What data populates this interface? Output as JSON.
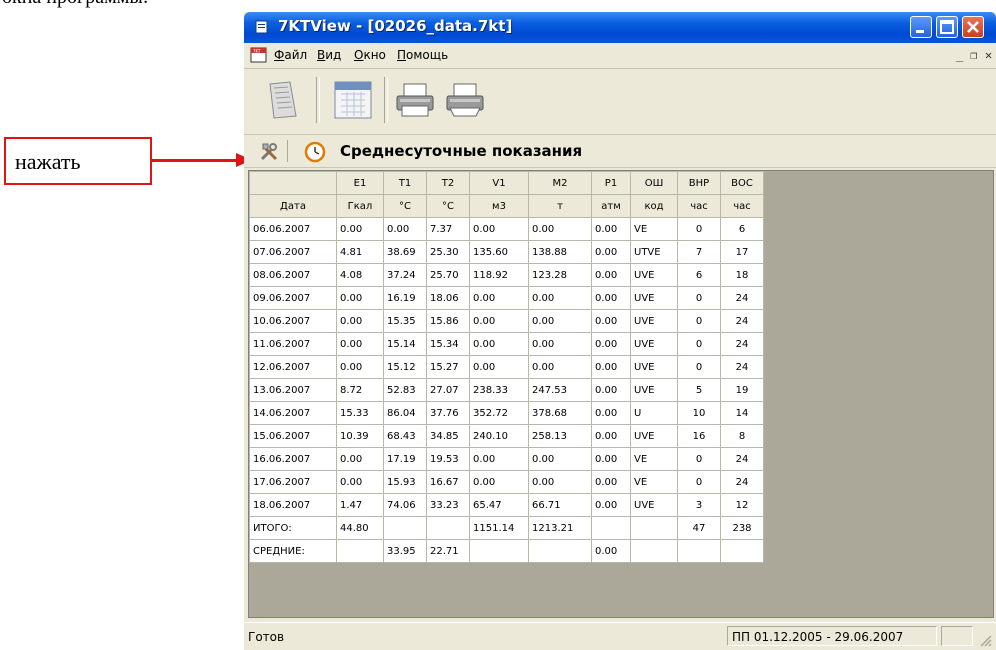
{
  "document": {
    "top_text": "окна программы:",
    "callout_text": "нажать"
  },
  "window": {
    "title": "7KTView - [02026_data.7kt]",
    "menu": [
      "Файл",
      "Вид",
      "Окно",
      "Помощь"
    ],
    "report_title": "Среднесуточные показания"
  },
  "table": {
    "columns": [
      "",
      "E1",
      "T1",
      "T2",
      "V1",
      "M2",
      "P1",
      "ОШ",
      "ВНР",
      "ВОС"
    ],
    "units": [
      "Дата",
      "Гкал",
      "°С",
      "°С",
      "м3",
      "т",
      "атм",
      "код",
      "час",
      "час"
    ],
    "rows": [
      [
        "06.06.2007",
        "0.00",
        "0.00",
        "7.37",
        "0.00",
        "0.00",
        "0.00",
        "VE",
        "0",
        "6"
      ],
      [
        "07.06.2007",
        "4.81",
        "38.69",
        "25.30",
        "135.60",
        "138.88",
        "0.00",
        "UTVE",
        "7",
        "17"
      ],
      [
        "08.06.2007",
        "4.08",
        "37.24",
        "25.70",
        "118.92",
        "123.28",
        "0.00",
        "UVE",
        "6",
        "18"
      ],
      [
        "09.06.2007",
        "0.00",
        "16.19",
        "18.06",
        "0.00",
        "0.00",
        "0.00",
        "UVE",
        "0",
        "24"
      ],
      [
        "10.06.2007",
        "0.00",
        "15.35",
        "15.86",
        "0.00",
        "0.00",
        "0.00",
        "UVE",
        "0",
        "24"
      ],
      [
        "11.06.2007",
        "0.00",
        "15.14",
        "15.34",
        "0.00",
        "0.00",
        "0.00",
        "UVE",
        "0",
        "24"
      ],
      [
        "12.06.2007",
        "0.00",
        "15.12",
        "15.27",
        "0.00",
        "0.00",
        "0.00",
        "UVE",
        "0",
        "24"
      ],
      [
        "13.06.2007",
        "8.72",
        "52.83",
        "27.07",
        "238.33",
        "247.53",
        "0.00",
        "UVE",
        "5",
        "19"
      ],
      [
        "14.06.2007",
        "15.33",
        "86.04",
        "37.76",
        "352.72",
        "378.68",
        "0.00",
        "U",
        "10",
        "14"
      ],
      [
        "15.06.2007",
        "10.39",
        "68.43",
        "34.85",
        "240.10",
        "258.13",
        "0.00",
        "UVE",
        "16",
        "8"
      ],
      [
        "16.06.2007",
        "0.00",
        "17.19",
        "19.53",
        "0.00",
        "0.00",
        "0.00",
        "VE",
        "0",
        "24"
      ],
      [
        "17.06.2007",
        "0.00",
        "15.93",
        "16.67",
        "0.00",
        "0.00",
        "0.00",
        "VE",
        "0",
        "24"
      ],
      [
        "18.06.2007",
        "1.47",
        "74.06",
        "33.23",
        "65.47",
        "66.71",
        "0.00",
        "UVE",
        "3",
        "12"
      ]
    ],
    "totals": [
      "ИТОГО:",
      "44.80",
      "",
      "",
      "1151.14",
      "1213.21",
      "",
      "",
      "47",
      "238"
    ],
    "averages": [
      "СРЕДНИЕ:",
      "",
      "33.95",
      "22.71",
      "",
      "",
      "0.00",
      "",
      "",
      ""
    ]
  },
  "statusbar": {
    "left": "Готов",
    "period": "ПП 01.12.2005 - 29.06.2007"
  },
  "icons": [
    "page-icon",
    "calendar-grid-icon",
    "printer-icon",
    "print-preview-icon",
    "tools-icon",
    "clock-icon"
  ],
  "colors": {
    "callout_red": "#e01414",
    "title_blue": "#0049d3",
    "face": "#ece9d8"
  }
}
